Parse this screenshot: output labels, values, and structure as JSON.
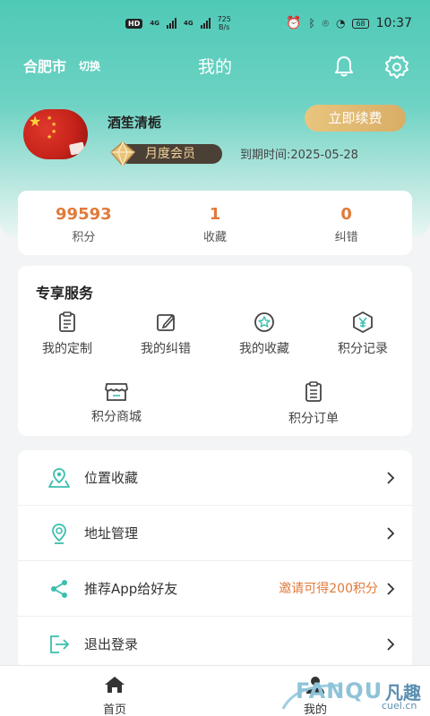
{
  "status_bar": {
    "hd_badge": "HD",
    "net_type_1": "4G",
    "net_type_2": "4G",
    "net_speed_value": "725",
    "net_speed_unit": "B/s",
    "battery": "68",
    "time": "10:37"
  },
  "header": {
    "city": "合肥市",
    "city_switch": "切换",
    "title": "我的"
  },
  "profile": {
    "username": "酒笙清栀",
    "renew_button": "立即续费",
    "membership": "月度会员",
    "expire_label": "到期时间:2025-05-28"
  },
  "stats": [
    {
      "value": "99593",
      "label": "积分"
    },
    {
      "value": "1",
      "label": "收藏"
    },
    {
      "value": "0",
      "label": "纠错"
    }
  ],
  "services": {
    "title": "专享服务",
    "items": [
      {
        "label": "我的定制",
        "icon": "clipboard-icon"
      },
      {
        "label": "我的纠错",
        "icon": "edit-icon"
      },
      {
        "label": "我的收藏",
        "icon": "star-badge-icon"
      },
      {
        "label": "积分记录",
        "icon": "yen-hexagon-icon"
      },
      {
        "label": "积分商城",
        "icon": "store-icon"
      },
      {
        "label": "积分订单",
        "icon": "order-list-icon"
      }
    ]
  },
  "menu": [
    {
      "label": "位置收藏",
      "icon": "location-bookmark-icon",
      "extra": ""
    },
    {
      "label": "地址管理",
      "icon": "map-pin-icon",
      "extra": ""
    },
    {
      "label": "推荐App给好友",
      "icon": "share-icon",
      "extra": "邀请可得200积分"
    },
    {
      "label": "退出登录",
      "icon": "logout-icon",
      "extra": ""
    }
  ],
  "bottom_nav": {
    "home": "首页",
    "mine": "我的"
  },
  "watermark": {
    "brand": "FANQU",
    "brand_cn": "凡趣",
    "url": "cuel.cn"
  },
  "colors": {
    "accent": "#4fc9b7",
    "orange": "#e07a3b",
    "gold": "#e8c57e",
    "icon_teal": "#3bbfae"
  }
}
